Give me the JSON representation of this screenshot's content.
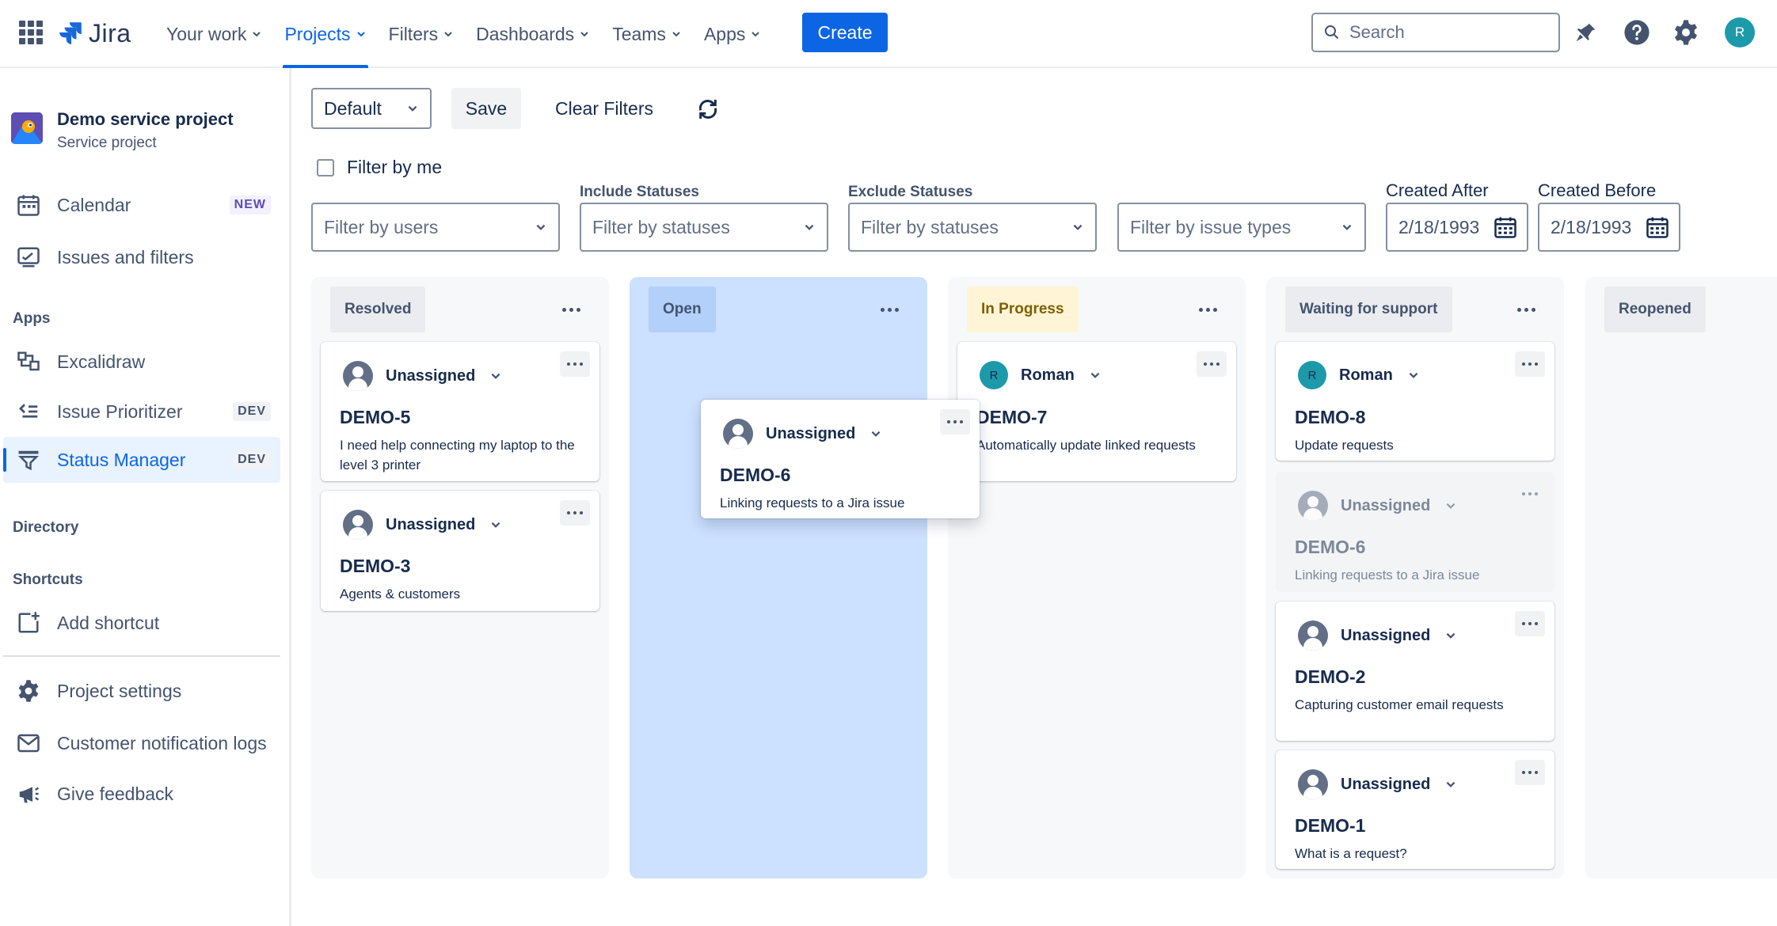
{
  "topnav": {
    "logo_text": "Jira",
    "items": [
      {
        "label": "Your work"
      },
      {
        "label": "Projects"
      },
      {
        "label": "Filters"
      },
      {
        "label": "Dashboards"
      },
      {
        "label": "Teams"
      },
      {
        "label": "Apps"
      }
    ],
    "create_label": "Create",
    "search_placeholder": "Search",
    "avatar_initial": "R"
  },
  "sidebar": {
    "project_name": "Demo service project",
    "project_type": "Service project",
    "items": [
      {
        "label": "Calendar",
        "badge": "NEW"
      },
      {
        "label": "Issues and filters"
      }
    ],
    "apps_heading": "Apps",
    "apps": [
      {
        "label": "Excalidraw"
      },
      {
        "label": "Issue Prioritizer",
        "badge": "DEV"
      },
      {
        "label": "Status Manager",
        "badge": "DEV"
      }
    ],
    "directory_heading": "Directory",
    "shortcuts_heading": "Shortcuts",
    "add_shortcut": "Add shortcut",
    "bottom": [
      {
        "label": "Project settings"
      },
      {
        "label": "Customer notification logs"
      },
      {
        "label": "Give feedback"
      }
    ]
  },
  "toolbar": {
    "view_select": "Default",
    "save_label": "Save",
    "clear_label": "Clear Filters",
    "filter_by_me": "Filter by me",
    "users_placeholder": "Filter by users",
    "include_label": "Include Statuses",
    "include_placeholder": "Filter by statuses",
    "exclude_label": "Exclude Statuses",
    "exclude_placeholder": "Filter by statuses",
    "types_placeholder": "Filter by issue types",
    "created_after_label": "Created After",
    "created_after_value": "2/18/1993",
    "created_before_label": "Created Before",
    "created_before_value": "2/18/1993"
  },
  "board": {
    "columns": [
      {
        "title": "Resolved"
      },
      {
        "title": "Open"
      },
      {
        "title": "In Progress"
      },
      {
        "title": "Waiting for support"
      },
      {
        "title": "Reopened"
      }
    ],
    "cards": {
      "demo5": {
        "assignee": "Unassigned",
        "key": "DEMO-5",
        "summary": "I need help connecting my laptop to the level 3 printer"
      },
      "demo3": {
        "assignee": "Unassigned",
        "key": "DEMO-3",
        "summary": "Agents & customers"
      },
      "demo6_drag": {
        "assignee": "Unassigned",
        "key": "DEMO-6",
        "summary": "Linking requests to a Jira issue"
      },
      "demo7": {
        "assignee": "Roman",
        "assignee_initial": "R",
        "key": "DEMO-7",
        "summary": "Automatically update linked requests"
      },
      "demo8": {
        "assignee": "Roman",
        "assignee_initial": "R",
        "key": "DEMO-8",
        "summary": "Update requests"
      },
      "demo6_ghost": {
        "assignee": "Unassigned",
        "key": "DEMO-6",
        "summary": "Linking requests to a Jira issue"
      },
      "demo2": {
        "assignee": "Unassigned",
        "key": "DEMO-2",
        "summary": "Capturing customer email requests"
      },
      "demo1": {
        "assignee": "Unassigned",
        "key": "DEMO-1",
        "summary": "What is a request?"
      }
    }
  },
  "colors": {
    "brand_blue": "#0c66e4",
    "open_column": "#cce0ff",
    "in_progress_header": "#fff5d6",
    "avatar_teal": "#1d9aaa"
  }
}
